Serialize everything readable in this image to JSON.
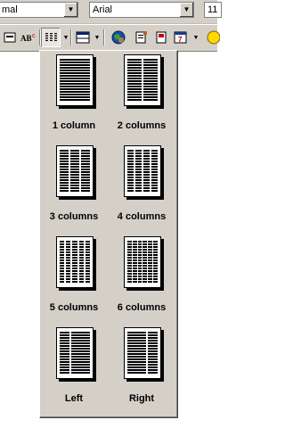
{
  "format_bar": {
    "style_value": "mal",
    "font_value": "Arial",
    "size_value": "11"
  },
  "toolbar": {
    "buttons": [
      "unknown-icon",
      "spelling-icon",
      "columns-icon",
      "table-icon",
      "globe-icon",
      "document-icon",
      "page-icon",
      "calendar-icon",
      "shape-icon"
    ]
  },
  "columns_menu": {
    "options": [
      {
        "label": "1 column",
        "cols": 1
      },
      {
        "label": "2 columns",
        "cols": 2
      },
      {
        "label": "3 columns",
        "cols": 3
      },
      {
        "label": "4 columns",
        "cols": 4
      },
      {
        "label": "5 columns",
        "cols": 5
      },
      {
        "label": "6 columns",
        "cols": 6
      },
      {
        "label": "Left",
        "cols": 2,
        "layout": "left"
      },
      {
        "label": "Right",
        "cols": 2,
        "layout": "right"
      }
    ]
  }
}
